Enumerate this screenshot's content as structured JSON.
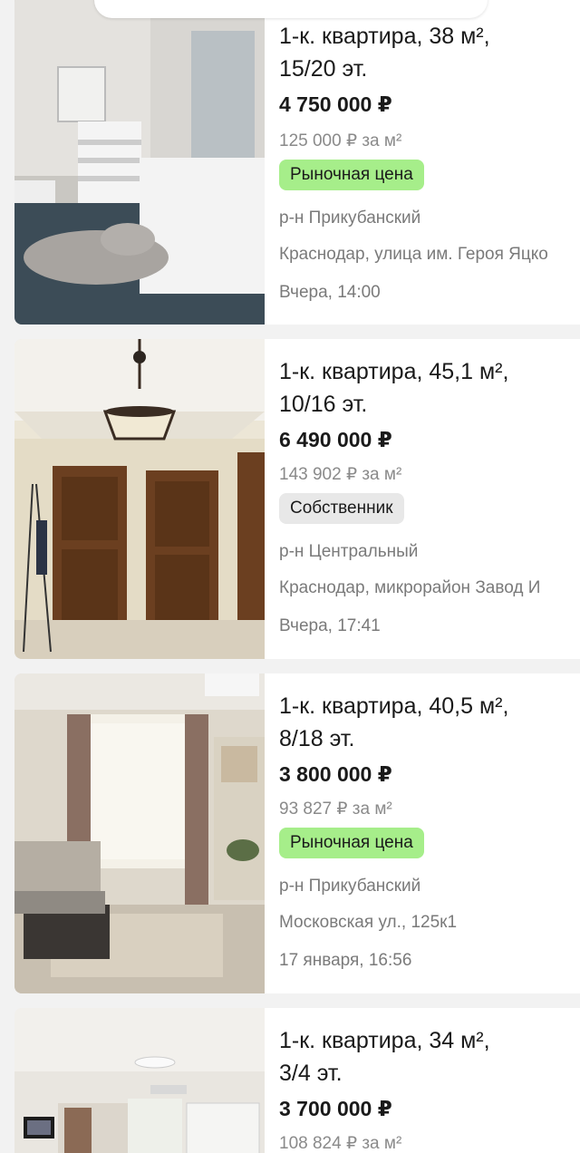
{
  "colors": {
    "market_badge": "#a6ee8a",
    "owner_badge": "#e8e8e8",
    "secondary_text": "#8a8a8a"
  },
  "listings": [
    {
      "title_line1": "1-к. квартира, 38 м²,",
      "title_line2": "15/20 эт.",
      "price": "4 750 000 ₽",
      "price_per_m2": "125 000 ₽ за м²",
      "badge": "Рыночная цена",
      "district": "р-н Прикубанский",
      "address": "Краснодар, улица им. Героя Яцко",
      "date": "Вчера, 14:00"
    },
    {
      "title_line1": "1-к. квартира, 45,1 м²,",
      "title_line2": "10/16 эт.",
      "price": "6 490 000 ₽",
      "price_per_m2": "143 902 ₽ за м²",
      "badge": "Собственник",
      "district": "р-н Центральный",
      "address": "Краснодар, микрорайон Завод И",
      "date": "Вчера, 17:41"
    },
    {
      "title_line1": "1-к. квартира, 40,5 м²,",
      "title_line2": "8/18 эт.",
      "price": "3 800 000 ₽",
      "price_per_m2": "93 827 ₽ за м²",
      "badge": "Рыночная цена",
      "district": "р-н Прикубанский",
      "address": "Московская ул., 125к1",
      "date": "17 января, 16:56"
    },
    {
      "title_line1": "1-к. квартира, 34 м²,",
      "title_line2": "3/4 эт.",
      "price": "3 700 000 ₽",
      "price_per_m2": "108 824 ₽ за м²"
    }
  ]
}
